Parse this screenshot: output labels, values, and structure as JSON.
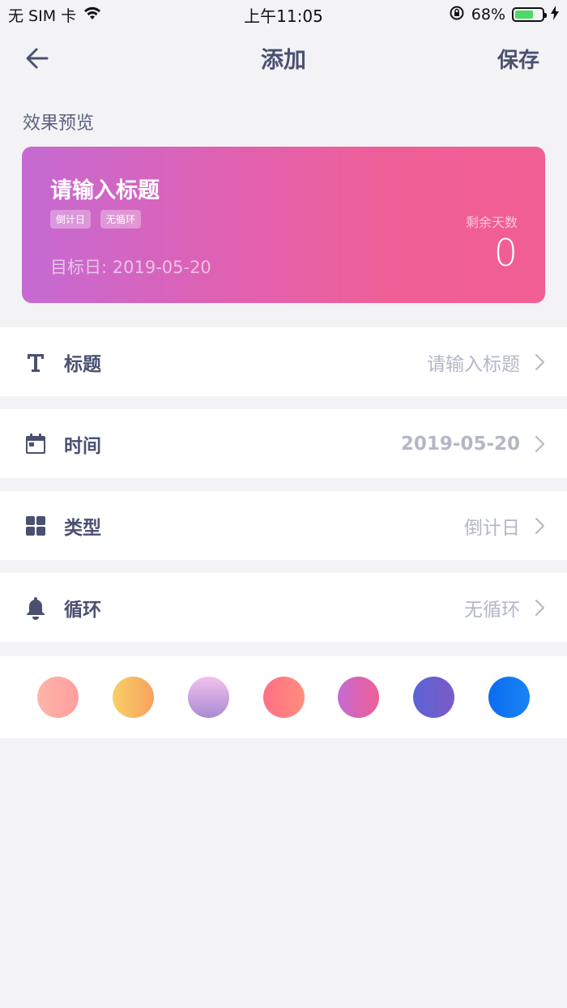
{
  "status_bar": {
    "carrier": "无 SIM 卡",
    "time": "上午11:05",
    "battery": "68%",
    "battery_level": 0.68
  },
  "nav": {
    "title": "添加",
    "save_label": "保存",
    "back_icon": "arrow-left-icon"
  },
  "preview": {
    "section_label": "效果预览",
    "title": "请输入标题",
    "tags": [
      "倒计日",
      "无循环"
    ],
    "target_date": "目标日: 2019-05-20",
    "remaining_label": "剩余天数",
    "remaining_value": "0",
    "gradient": [
      "#c56ad3",
      "#f05e94"
    ]
  },
  "rows": [
    {
      "icon": "text-icon",
      "label": "标题",
      "value": "请输入标题"
    },
    {
      "icon": "calendar-icon",
      "label": "时间",
      "value": "2019-05-20"
    },
    {
      "icon": "grid-icon",
      "label": "类型",
      "value": "倒计日"
    },
    {
      "icon": "bell-icon",
      "label": "循环",
      "value": "无循环"
    }
  ],
  "colors": [
    [
      "#ffb5a8",
      "#ff9e9e"
    ],
    [
      "#f9cf68",
      "#f7a25e"
    ],
    [
      "#f2c1ee",
      "#a88bd2"
    ],
    [
      "#ff6f85",
      "#ff8e7c"
    ],
    [
      "#c56ad3",
      "#f05e94"
    ],
    [
      "#5b63d6",
      "#7b5bc5"
    ],
    [
      "#0a6cf0",
      "#1a84f5"
    ]
  ]
}
